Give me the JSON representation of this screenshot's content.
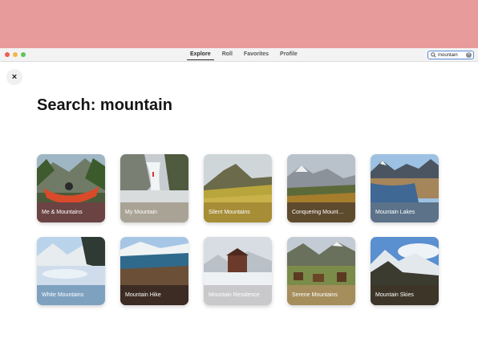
{
  "window": {
    "tabs": [
      {
        "label": "Explore",
        "active": true
      },
      {
        "label": "Roll",
        "active": false
      },
      {
        "label": "Favorites",
        "active": false
      },
      {
        "label": "Profile",
        "active": false
      }
    ],
    "search": {
      "value": "mountain",
      "icon": "search-icon"
    }
  },
  "page": {
    "close_icon": "×",
    "title": "Search: mountain"
  },
  "results": [
    {
      "label": "Me & Mountains",
      "band_color": "#6b4343"
    },
    {
      "label": "My Mountain",
      "band_color": "#a8a395"
    },
    {
      "label": "Silent Mountains",
      "band_color": "#a68d36"
    },
    {
      "label": "Conquering Mount…",
      "band_color": "#5e4a2d"
    },
    {
      "label": "Mountain Lakes",
      "band_color": "#5b7289"
    },
    {
      "label": "White Mountains",
      "band_color": "#7ea1c0"
    },
    {
      "label": "Mountain Hike",
      "band_color": "#3c2c24"
    },
    {
      "label": "Mountain Residence",
      "band_color": "#c9c9cc"
    },
    {
      "label": "Serene Mountains",
      "band_color": "#a58e5c"
    },
    {
      "label": "Mountain Skies",
      "band_color": "#3d3628"
    }
  ]
}
